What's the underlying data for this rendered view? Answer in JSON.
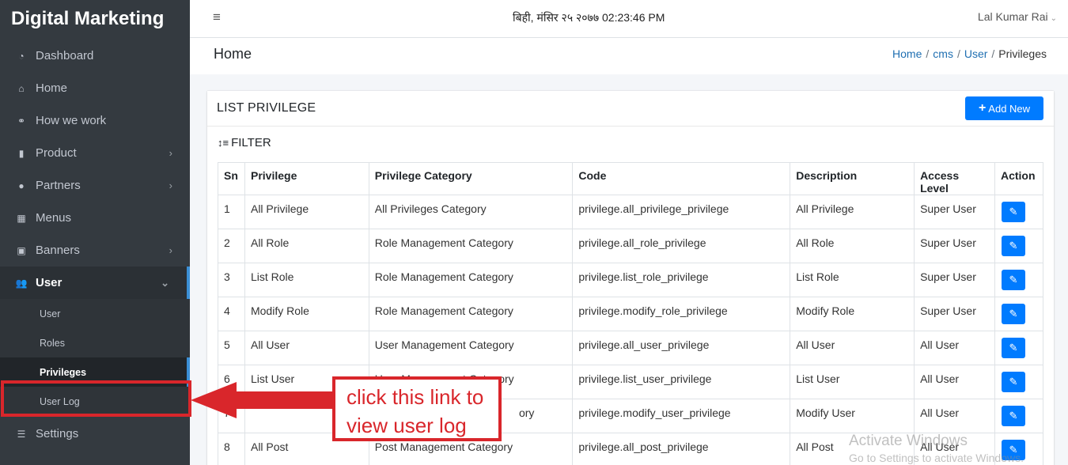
{
  "brand": "Digital Marketing",
  "sidebar": {
    "items": [
      {
        "label": "Dashboard",
        "icon": "dashboard-icon",
        "glyph": "◔"
      },
      {
        "label": "Home",
        "icon": "home-icon",
        "glyph": "⌂"
      },
      {
        "label": "How we work",
        "icon": "handshake-icon",
        "glyph": "⚭"
      },
      {
        "label": "Product",
        "icon": "book-icon",
        "glyph": "▮"
      },
      {
        "label": "Partners",
        "icon": "user-circle-icon",
        "glyph": "●"
      },
      {
        "label": "Menus",
        "icon": "grid-icon",
        "glyph": "▦"
      },
      {
        "label": "Banners",
        "icon": "images-icon",
        "glyph": "▣"
      },
      {
        "label": "User",
        "icon": "users-icon",
        "glyph": "👥"
      }
    ],
    "chevron": "›",
    "chevron_open": "⌄",
    "sub_items": [
      "User",
      "Roles",
      "Privileges",
      "User Log"
    ],
    "settings": {
      "label": "Settings",
      "glyph": "☰"
    }
  },
  "topbar": {
    "menu_glyph": "≡",
    "datetime": "बिही, मंसिर २५ २०७७ 02:23:46 PM",
    "user": "Lal Kumar Rai",
    "caret": "⌄"
  },
  "header": {
    "title": "Home",
    "breadcrumb": [
      "Home",
      "cms",
      "User",
      "Privileges"
    ],
    "separator": "/"
  },
  "card": {
    "title": "LIST PRIVILEGE",
    "add_button": "Add New",
    "plus": "+",
    "filter_label": "FILTER",
    "filter_glyph": "↕≡"
  },
  "table": {
    "columns": [
      "Sn",
      "Privilege",
      "Privilege Category",
      "Code",
      "Description",
      "Access Level",
      "Action"
    ],
    "edit_glyph": "✎",
    "rows": [
      [
        "1",
        "All Privilege",
        "All Privileges Category",
        "privilege.all_privilege_privilege",
        "All Privilege",
        "Super User"
      ],
      [
        "2",
        "All Role",
        "Role Management Category",
        "privilege.all_role_privilege",
        "All Role",
        "Super User"
      ],
      [
        "3",
        "List Role",
        "Role Management Category",
        "privilege.list_role_privilege",
        "List Role",
        "Super User"
      ],
      [
        "4",
        "Modify Role",
        "Role Management Category",
        "privilege.modify_role_privilege",
        "Modify Role",
        "Super User"
      ],
      [
        "5",
        "All User",
        "User Management Category",
        "privilege.all_user_privilege",
        "All User",
        "All User"
      ],
      [
        "6",
        "List User",
        "User Management Category",
        "privilege.list_user_privilege",
        "List User",
        "All User"
      ],
      [
        "7",
        "",
        "",
        "privilege.modify_user_privilege",
        "Modify User",
        "All User"
      ],
      [
        "8",
        "All Post",
        "Post Management Category",
        "privilege.all_post_privilege",
        "All Post",
        "All User"
      ]
    ],
    "partial_row_7_category": "ory"
  },
  "annotation": {
    "callout_line1": "click this link to",
    "callout_line2": "view user log",
    "color": "#d9262b"
  },
  "watermark": {
    "line1": "Activate Windows",
    "line2": "Go to Settings to activate Windows."
  }
}
